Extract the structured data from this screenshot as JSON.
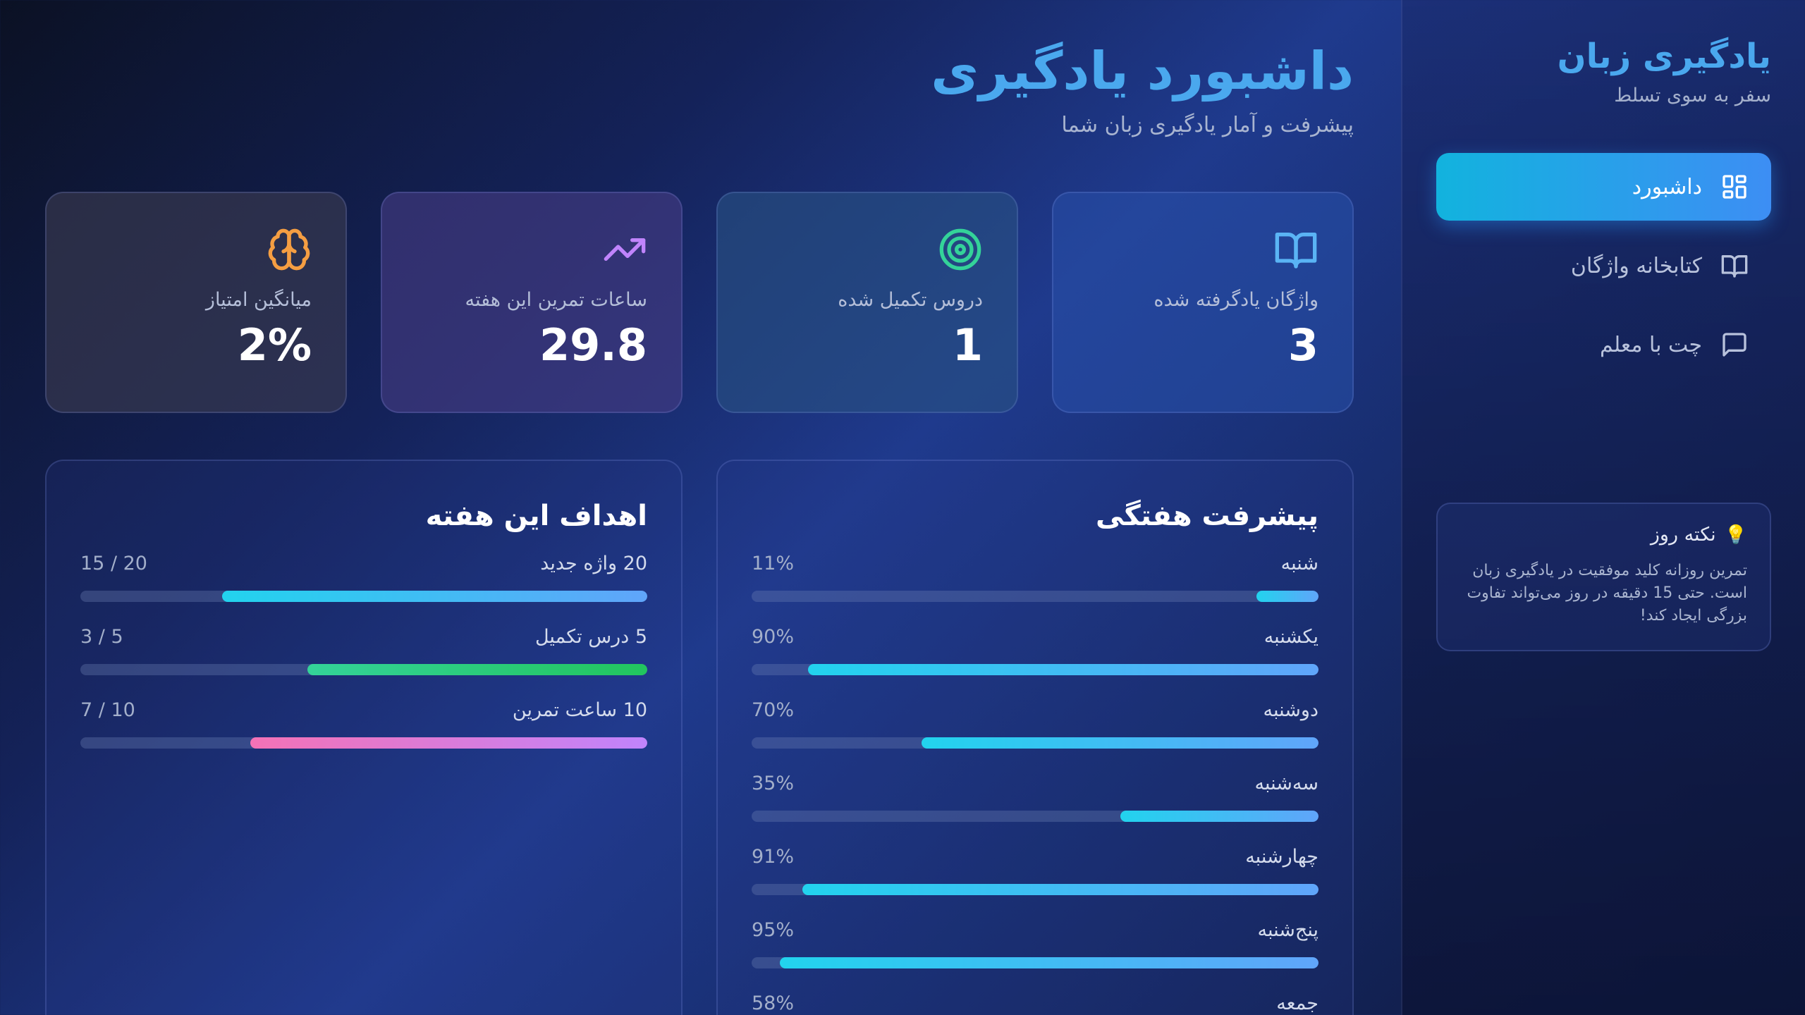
{
  "sidebar": {
    "title": "یادگیری زبان",
    "subtitle": "سفر به سوی تسلط",
    "nav": [
      {
        "label": "داشبورد",
        "icon": "dashboard-grid-icon",
        "active": true
      },
      {
        "label": "کتابخانه واژگان",
        "icon": "book-icon",
        "active": false
      },
      {
        "label": "چت با معلم",
        "icon": "chat-bubble-icon",
        "active": false
      }
    ],
    "tip": {
      "title": "نکته روز",
      "icon": "lightbulb-icon",
      "text": "تمرین روزانه کلید موفقیت در یادگیری زبان است. حتی 15 دقیقه در روز می‌تواند تفاوت بزرگی ایجاد کند!"
    }
  },
  "header": {
    "title": "داشبورد یادگیری",
    "subtitle": "پیشرفت و آمار یادگیری زبان شما"
  },
  "stats": [
    {
      "label": "واژگان یادگرفته شده",
      "value": "3",
      "icon": "book-icon",
      "color": "#5ab4f5"
    },
    {
      "label": "دروس تکمیل شده",
      "value": "1",
      "icon": "target-icon",
      "color": "#34d399"
    },
    {
      "label": "ساعات تمرین این هفته",
      "value": "29.8",
      "icon": "trending-up-icon",
      "color": "#c084fc"
    },
    {
      "label": "میانگین امتیاز",
      "value": "2%",
      "icon": "brain-icon",
      "color": "#f59e42"
    }
  ],
  "weekly_progress": {
    "title": "پیشرفت هفتگی",
    "days": [
      {
        "day": "شنبه",
        "percent_label": "11%",
        "fraction": 0.11
      },
      {
        "day": "یکشنبه",
        "percent_label": "90%",
        "fraction": 0.9
      },
      {
        "day": "دوشنبه",
        "percent_label": "70%",
        "fraction": 0.7
      },
      {
        "day": "سه‌شنبه",
        "percent_label": "35%",
        "fraction": 0.35
      },
      {
        "day": "چهارشنبه",
        "percent_label": "91%",
        "fraction": 0.91
      },
      {
        "day": "پنج‌شنبه",
        "percent_label": "95%",
        "fraction": 0.95
      },
      {
        "day": "جمعه",
        "percent_label": "58%",
        "fraction": 0.58
      }
    ]
  },
  "weekly_goals": {
    "title": "اهداف این هفته",
    "goals": [
      {
        "label": "20 واژه جدید",
        "progress_label": "20 / 15",
        "fraction": 0.75,
        "color": "blue"
      },
      {
        "label": "5 درس تکمیل",
        "progress_label": "5 / 3",
        "fraction": 0.6,
        "color": "green"
      },
      {
        "label": "10 ساعت تمرین",
        "progress_label": "10 / 7",
        "fraction": 0.7,
        "color": "pink"
      }
    ]
  }
}
